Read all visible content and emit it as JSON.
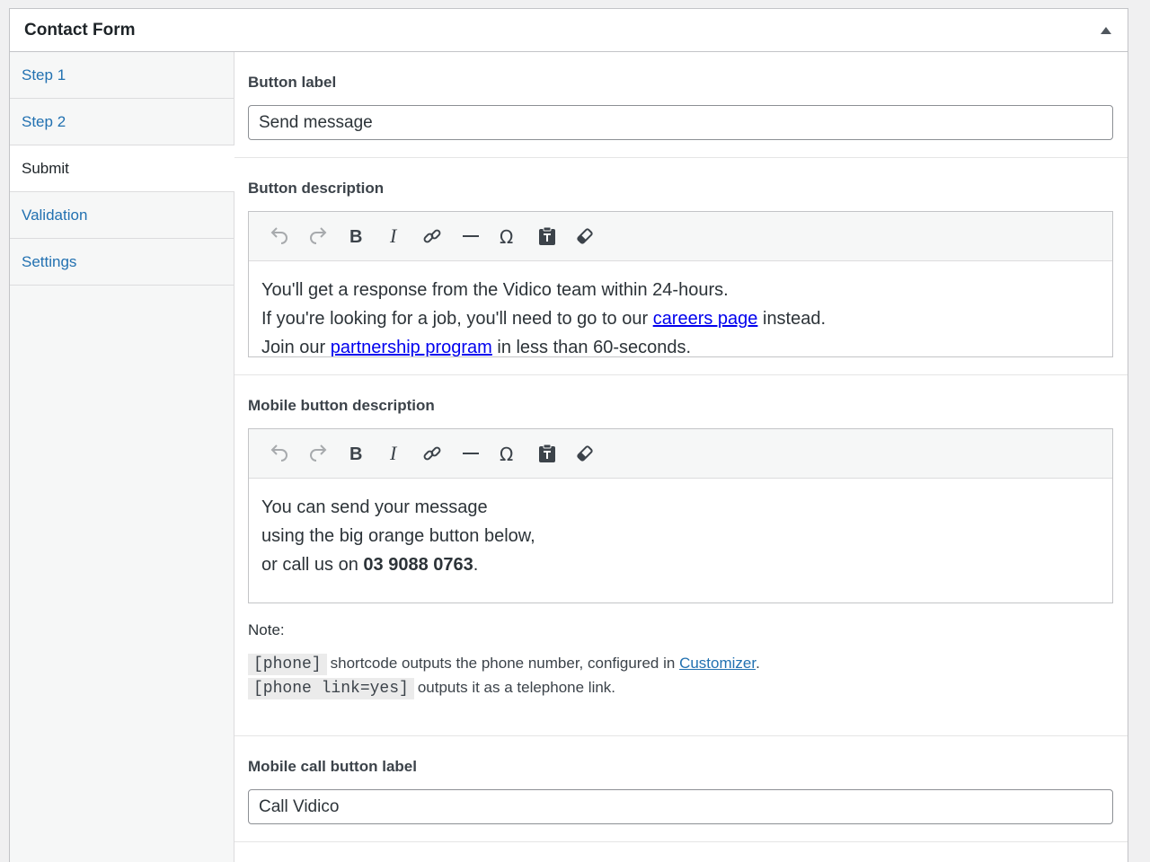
{
  "panel": {
    "title": "Contact Form"
  },
  "sidebar": {
    "tabs": [
      {
        "label": "Step 1",
        "active": false
      },
      {
        "label": "Step 2",
        "active": false
      },
      {
        "label": "Submit",
        "active": true
      },
      {
        "label": "Validation",
        "active": false
      },
      {
        "label": "Settings",
        "active": false
      }
    ]
  },
  "fields": {
    "button_label": {
      "label": "Button label",
      "value": "Send message"
    },
    "button_description": {
      "label": "Button description",
      "line1": "You'll get a response from the Vidico team within 24-hours.",
      "line2_pre": "If you're looking for a job, you'll need to go to our ",
      "line2_link": "careers page",
      "line2_post": " instead.",
      "line3_pre": "Join our ",
      "line3_link": "partnership program",
      "line3_post": " in less than 60-seconds."
    },
    "mobile_button_description": {
      "label": "Mobile button description",
      "line1": "You can send your message",
      "line2": "using the big orange button below,",
      "line3_pre": "or call us on ",
      "line3_bold": "03 9088 0763",
      "line3_post": "."
    },
    "note": {
      "label": "Note:",
      "code1": "[phone]",
      "text1_pre": "shortcode outputs the phone number, configured in ",
      "text1_link": "Customizer",
      "text1_post": ".",
      "code2": "[phone link=yes]",
      "text2": "outputs it as a telephone link."
    },
    "mobile_call_button_label": {
      "label": "Mobile call button label",
      "value": "Call Vidico"
    }
  },
  "toolbar_icons": [
    "undo-icon",
    "redo-icon",
    "bold-icon",
    "italic-icon",
    "link-icon",
    "horizontal-line-icon",
    "special-character-icon",
    "paste-as-text-icon",
    "clear-formatting-icon"
  ],
  "colors": {
    "link": "#2271b1",
    "content_link": "#0000ee",
    "border": "#c3c4c7"
  }
}
